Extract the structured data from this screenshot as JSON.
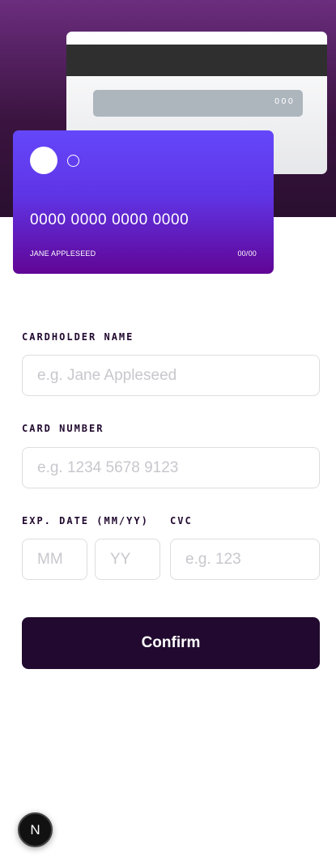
{
  "card": {
    "number": "0000 0000 0000 0000",
    "name": "JANE APPLESEED",
    "expiry": "00/00",
    "cvc": "000"
  },
  "form": {
    "name_label": "CARDHOLDER NAME",
    "name_placeholder": "e.g. Jane Appleseed",
    "number_label": "CARD NUMBER",
    "number_placeholder": "e.g. 1234 5678 9123",
    "exp_label": "EXP. DATE (MM/YY)",
    "mm_placeholder": "MM",
    "yy_placeholder": "YY",
    "cvc_label": "CVC",
    "cvc_placeholder": "e.g. 123",
    "confirm_label": "Confirm"
  },
  "badge": {
    "label": "N"
  },
  "colors": {
    "dark_violet": "#21092f",
    "gradient_start": "#6447fa",
    "gradient_end": "#610595"
  }
}
